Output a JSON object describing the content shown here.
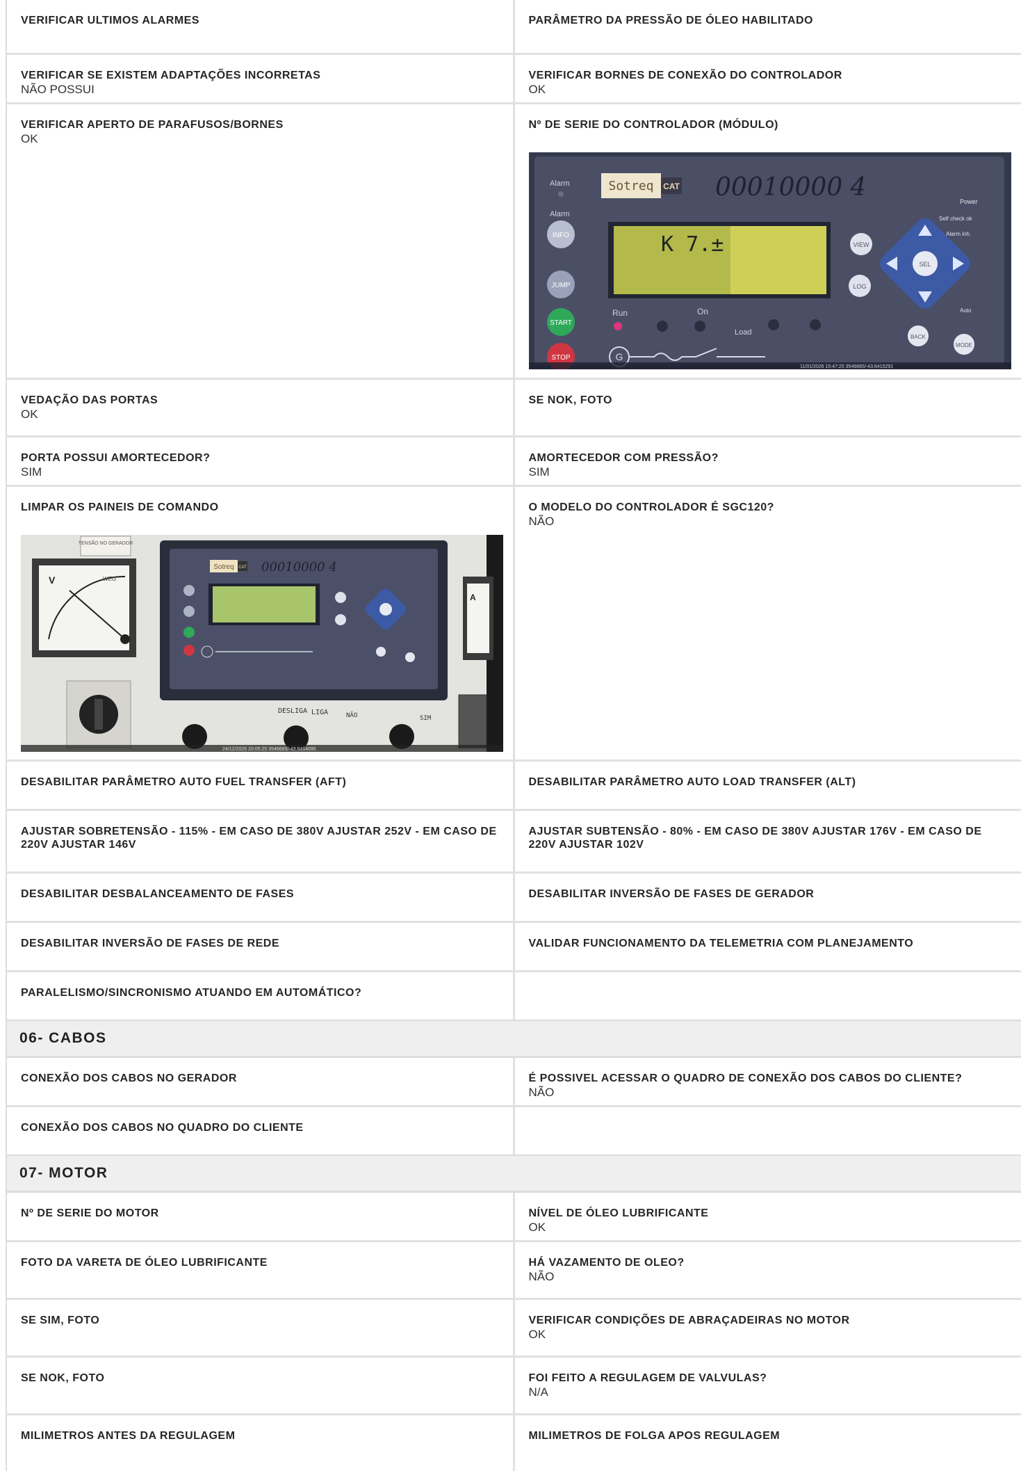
{
  "rows_a": [
    {
      "left": {
        "label": "VERIFICAR ULTIMOS ALARMES",
        "value": ""
      },
      "right": {
        "label": "PARÂMETRO DA PRESSÃO DE ÓLEO HABILITADO",
        "value": ""
      }
    },
    {
      "left": {
        "label": "VERIFICAR SE EXISTEM ADAPTAÇÕES INCORRETAS",
        "value": "NÃO POSSUI"
      },
      "right": {
        "label": "VERIFICAR BORNES DE CONEXÃO DO CONTROLADOR",
        "value": "OK"
      }
    },
    {
      "left": {
        "label": "VERIFICAR APERTO DE PARAFUSOS/BORNES",
        "value": "OK"
      },
      "right": {
        "label": "Nº DE SERIE DO CONTROLADOR (MÓDULO)",
        "value": ""
      }
    },
    {
      "left": {
        "label": "VEDAÇÃO DAS PORTAS",
        "value": "OK"
      },
      "right": {
        "label": "SE NOK, FOTO",
        "value": ""
      }
    },
    {
      "left": {
        "label": "PORTA POSSUI AMORTECEDOR?",
        "value": "SIM"
      },
      "right": {
        "label": "AMORTECEDOR COM PRESSÃO?",
        "value": "SIM"
      }
    },
    {
      "left": {
        "label": "LIMPAR OS PAINEIS DE COMANDO",
        "value": ""
      },
      "right": {
        "label": "O MODELO DO CONTROLADOR É SGC120?",
        "value": "NÃO"
      }
    },
    {
      "left": {
        "label": "DESABILITAR PARÂMETRO AUTO FUEL TRANSFER (AFT)",
        "value": ""
      },
      "right": {
        "label": "DESABILITAR PARÂMETRO AUTO LOAD TRANSFER (ALT)",
        "value": ""
      }
    },
    {
      "left": {
        "label": "AJUSTAR SOBRETENSÃO - 115% - EM CASO DE 380V AJUSTAR 252V - EM CASO DE 220V AJUSTAR 146V",
        "value": ""
      },
      "right": {
        "label": "AJUSTAR SUBTENSÃO - 80% - EM CASO DE 380V AJUSTAR 176V - EM CASO DE 220V AJUSTAR 102V",
        "value": ""
      }
    },
    {
      "left": {
        "label": "DESABILITAR DESBALANCEAMENTO DE FASES",
        "value": ""
      },
      "right": {
        "label": "DESABILITAR INVERSÃO DE FASES DE GERADOR",
        "value": ""
      }
    },
    {
      "left": {
        "label": "DESABILITAR INVERSÃO DE FASES DE REDE",
        "value": ""
      },
      "right": {
        "label": "VALIDAR FUNCIONAMENTO DA TELEMETRIA COM PLANEJAMENTO",
        "value": ""
      }
    },
    {
      "left": {
        "label": "PARALELISMO/SINCRONISMO ATUANDO EM AUTOMÁTICO?",
        "value": ""
      },
      "right": {
        "label": "",
        "value": ""
      }
    }
  ],
  "section_cabos": "06- CABOS",
  "rows_b": [
    {
      "left": {
        "label": "CONEXÃO DOS CABOS NO GERADOR",
        "value": ""
      },
      "right": {
        "label": "É POSSIVEL ACESSAR O QUADRO DE CONEXÃO DOS CABOS DO CLIENTE?",
        "value": "NÃO"
      }
    },
    {
      "left": {
        "label": "CONEXÃO DOS CABOS NO QUADRO DO CLIENTE",
        "value": ""
      },
      "right": {
        "label": "",
        "value": ""
      }
    }
  ],
  "section_motor": "07- MOTOR",
  "rows_c": [
    {
      "left": {
        "label": "Nº DE SERIE DO MOTOR",
        "value": ""
      },
      "right": {
        "label": "NÍVEL DE ÓLEO LUBRIFICANTE",
        "value": "OK"
      }
    },
    {
      "left": {
        "label": "FOTO DA VARETA DE ÓLEO LUBRIFICANTE",
        "value": ""
      },
      "right": {
        "label": "HÁ VAZAMENTO DE OLEO?",
        "value": "NÃO"
      }
    },
    {
      "left": {
        "label": "SE SIM, FOTO",
        "value": ""
      },
      "right": {
        "label": "VERIFICAR CONDIÇÕES DE ABRAÇADEIRAS NO MOTOR",
        "value": "OK"
      }
    },
    {
      "left": {
        "label": "SE NOK, FOTO",
        "value": ""
      },
      "right": {
        "label": "FOI FEITO A REGULAGEM DE VALVULAS?",
        "value": "N/A"
      }
    },
    {
      "left": {
        "label": "MILIMETROS ANTES DA REGULAGEM",
        "value": ""
      },
      "right": {
        "label": "MILIMETROS DE FOLGA APOS REGULAGEM",
        "value": ""
      }
    }
  ],
  "photos": {
    "controller": {
      "brand": "Sotreq",
      "brand_badge": "CAT",
      "handwritten_serial": "00010000 4",
      "display_text": "K 7.±",
      "buttons": [
        "INFO",
        "JUMP",
        "START",
        "STOP",
        "VIEW",
        "LOG",
        "SEL",
        "BACK",
        "MODE"
      ],
      "indicators": [
        "Alarm",
        "Alarm",
        "Run",
        "On",
        "Load",
        "Power",
        "Self check ok",
        "Alarm inh.",
        "Auto"
      ],
      "timestamp": "11/01/2026 15:47:25 3546665/-43.6415291"
    },
    "panel": {
      "brand": "Sotreq",
      "brand_badge": "CAT",
      "handwritten_serial": "00010000 4",
      "gauge_caption": "TENSÃO NO GERADOR",
      "gauge_brand": "WEG",
      "switch_labels": [
        "DESLIGA",
        "LIGA",
        "NÃO",
        "SIM"
      ],
      "timestamp": "24/12/2025 20:05:25 3546665/-43.6414095"
    }
  }
}
